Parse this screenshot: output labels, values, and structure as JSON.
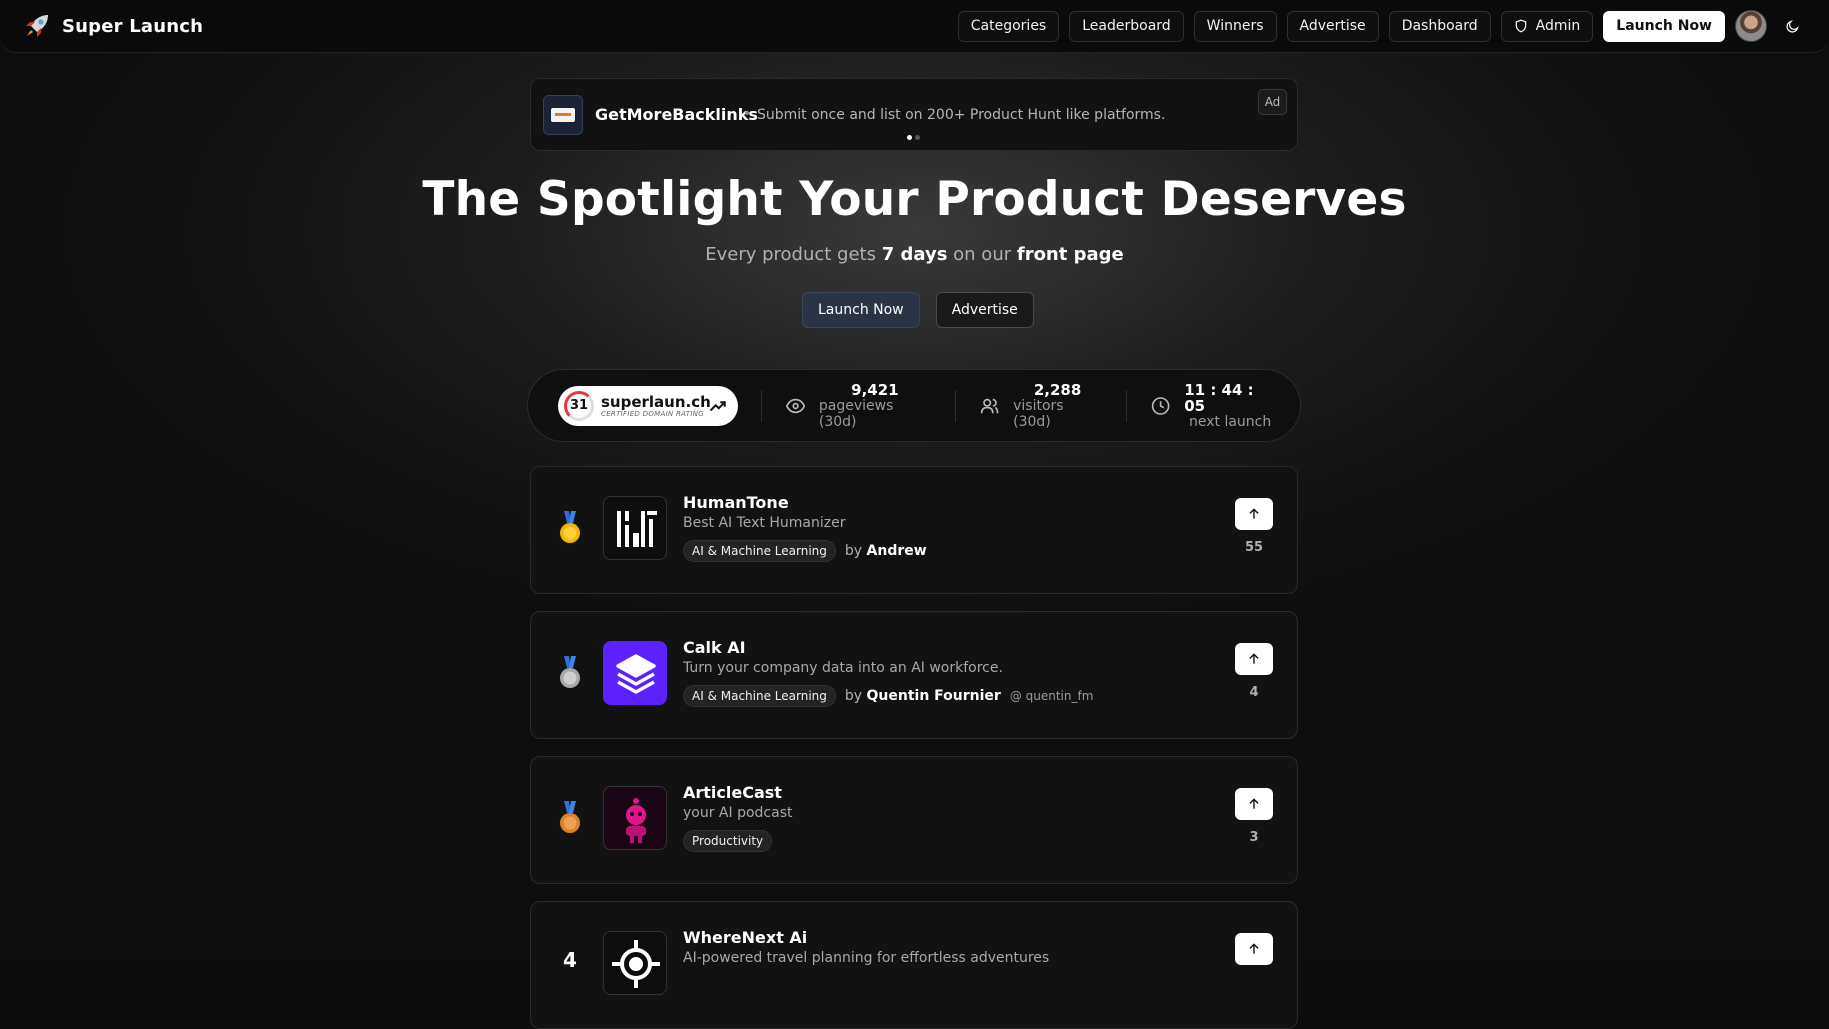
{
  "header": {
    "brand": "Super Launch",
    "nav": [
      "Categories",
      "Leaderboard",
      "Winners",
      "Advertise",
      "Dashboard",
      "Admin"
    ],
    "cta": "Launch Now"
  },
  "ad": {
    "title": "GetMoreBacklinks",
    "separator": "•",
    "text": "Submit once and list on 200+ Product Hunt like platforms.",
    "badge": "Ad"
  },
  "hero": {
    "title": "The Spotlight Your Product Deserves",
    "sub_prefix": "Every product gets ",
    "sub_days": "7 days",
    "sub_mid": " on our ",
    "sub_page": "front page",
    "launch_button": "Launch Now",
    "advertise_button": "Advertise"
  },
  "stats": {
    "domain_rating": "31",
    "domain": "superlaun.ch",
    "domain_caption": "CERTIFIED DOMAIN RATING",
    "pageviews_value": "9,421",
    "pageviews_label": "pageviews (30d)",
    "visitors_value": "2,288",
    "visitors_label": "visitors (30d)",
    "countdown_value": "11 : 44 : 05",
    "countdown_label": "next launch"
  },
  "products": [
    {
      "name": "HumanTone",
      "desc": "Best AI Text Humanizer",
      "tag": "AI & Machine Learning",
      "by_prefix": "by",
      "author": "Andrew",
      "handle": "",
      "votes": "55"
    },
    {
      "name": "Calk AI",
      "desc": "Turn your company data into an AI workforce.",
      "tag": "AI & Machine Learning",
      "by_prefix": "by",
      "author": "Quentin Fournier",
      "handle": "@ quentin_fm",
      "votes": "4"
    },
    {
      "name": "ArticleCast",
      "desc": "your AI podcast",
      "tag": "Productivity",
      "by_prefix": "",
      "author": "",
      "handle": "",
      "votes": "3"
    },
    {
      "name": "WhereNext Ai",
      "desc": "AI-powered travel planning for effortless adventures",
      "tag": "",
      "by_prefix": "",
      "author": "",
      "handle": "",
      "votes": ""
    }
  ],
  "icons": [
    "rocket-icon",
    "shield-icon",
    "moon-icon",
    "eye-icon",
    "users-icon",
    "clock-icon",
    "trend-up-icon",
    "arrow-up-icon",
    "medal-gold-icon",
    "medal-silver-icon",
    "medal-bronze-icon"
  ],
  "colors": {
    "accent_launch": "#2b3444",
    "dr_red": "#e53935",
    "calk_purple": "#5b21ff",
    "articlecast_pink": "#e0158e"
  }
}
